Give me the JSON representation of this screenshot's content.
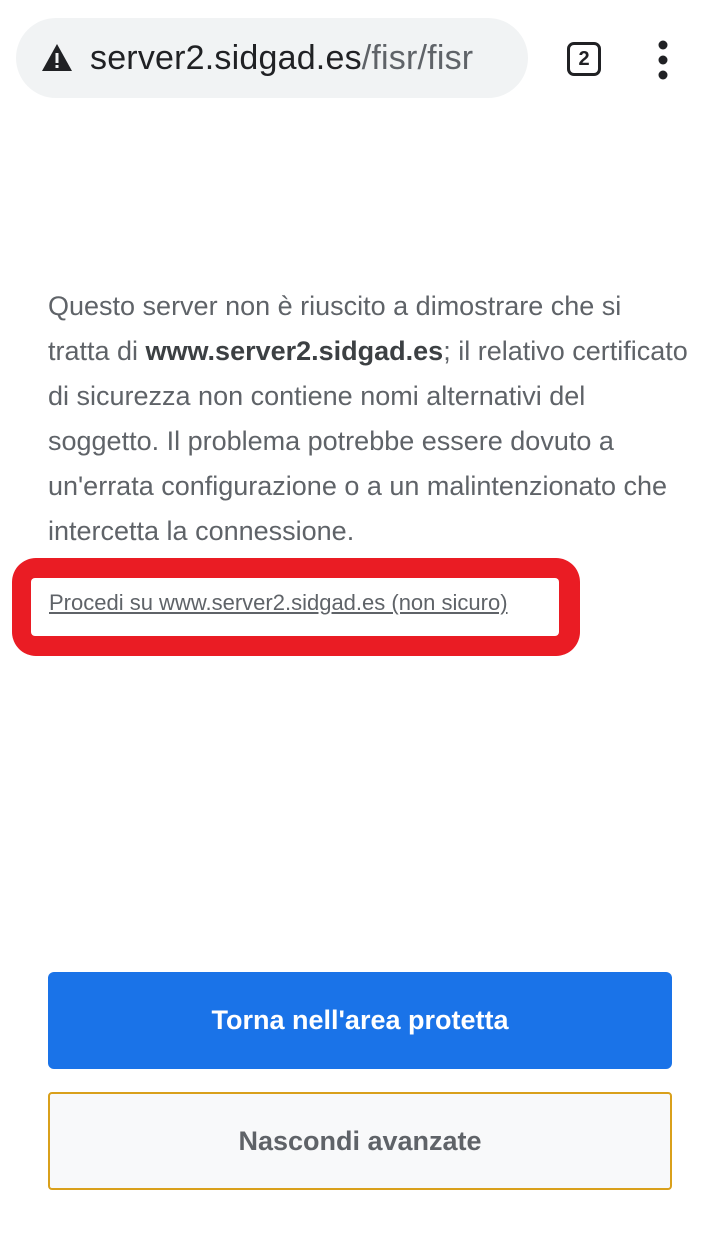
{
  "browser": {
    "url_host": "server2.sidgad.es",
    "url_path": "/fisr/fisr",
    "tab_count": "2",
    "security_icon": "warning-triangle-icon",
    "menu_icon": "more-vert-icon"
  },
  "interstitial": {
    "text_before": "Questo server non è riuscito a dimostrare che si tratta di ",
    "domain_bold": "www.server2.sidgad.es",
    "text_after": "; il relativo certificato di sicurezza non contiene nomi alternativi del soggetto. Il problema potrebbe essere dovuto a un'errata configurazione o a un malintenzionato che intercetta la connessione.",
    "proceed_link": "Procedi su www.server2.sidgad.es (non sicuro)",
    "back_button": "Torna nell'area protetta",
    "hide_advanced_button": "Nascondi avanzate"
  },
  "colors": {
    "primary": "#1a73e8",
    "highlight": "#ea1c24",
    "focus_outline": "#d9a01b"
  }
}
